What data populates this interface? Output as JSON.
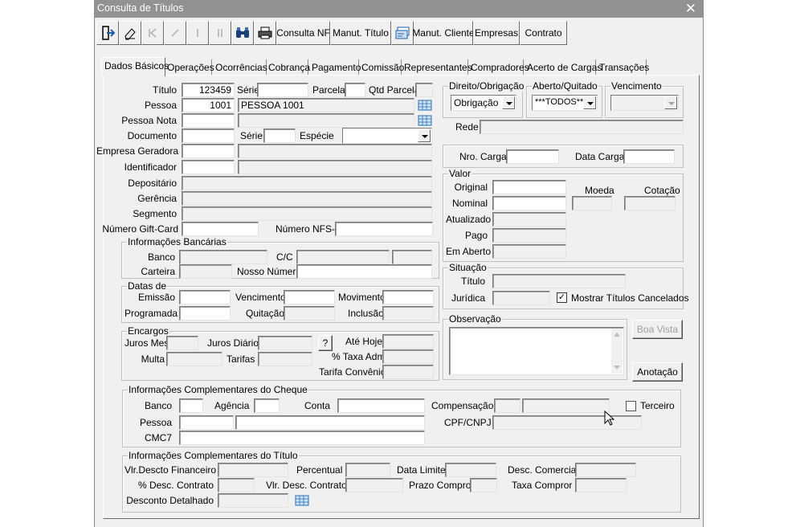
{
  "window": {
    "title": "Consulta de Títulos",
    "close_glyph": "✕"
  },
  "toolbar": {
    "exit_icon": "exit-door-icon",
    "eraser_icon": "eraser-icon",
    "first_icon": "first-record-icon",
    "confirm_icon": "check-icon",
    "bar_icon": "bar-icon",
    "pause_icon": "pause-icon",
    "search_icon": "binoculars-icon",
    "print_icon": "printer-icon",
    "consulta_nf": "Consulta NF",
    "manut_titulo": "Manut. Título",
    "card_icon": "card-icon",
    "manut_cliente": "Manut. Cliente",
    "empresas": "Empresas",
    "contrato": "Contrato"
  },
  "tabs": [
    "Dados Básicos",
    "Operações",
    "Ocorrências",
    "Cobrança",
    "Pagamento",
    "Comissão",
    "Representantes",
    "Compradores",
    "Acerto de Cargas",
    "Transações"
  ],
  "basic": {
    "titulo_label": "Título",
    "titulo_value": "123459",
    "serie_label": "Série",
    "parcela_label": "Parcela",
    "qtd_parcela_label": "Qtd Parcela",
    "pessoa_label": "Pessoa",
    "pessoa_code": "1001",
    "pessoa_name": "PESSOA 1001",
    "pessoa_nota_label": "Pessoa Nota",
    "documento_label": "Documento",
    "doc_serie_label": "Série",
    "especie_label": "Espécie",
    "empresa_geradora_label": "Empresa Geradora",
    "identificador_label": "Identificador",
    "depositario_label": "Depositário",
    "gerencia_label": "Gerência",
    "segmento_label": "Segmento",
    "gift_card_label": "Número Gift-Card",
    "nfse_label": "Número NFS-e"
  },
  "bancarias": {
    "legend": "Informações Bancárias",
    "banco_label": "Banco",
    "cc_label": "C/C",
    "carteira_label": "Carteira",
    "nosso_numero_label": "Nosso Número"
  },
  "datas": {
    "legend": "Datas de",
    "emissao": "Emissão",
    "vencimento": "Vencimento",
    "movimento": "Movimento",
    "programada": "Programada",
    "quitacao": "Quitação",
    "inclusao": "Inclusão"
  },
  "encargos": {
    "legend": "Encargos",
    "juros_mes": "Juros Mes",
    "juros_diario": "Juros Diário",
    "help_button": "?",
    "ate_hoje": "Até Hoje",
    "multa": "Multa",
    "tarifas": "Tarifas",
    "taxa_adm": "% Taxa Adm",
    "tarifa_convenio": "Tarifa Convênio"
  },
  "direito": {
    "legend": "Direito/Obrigação",
    "value": "Obrigação"
  },
  "aberto": {
    "legend": "Aberto/Quitado",
    "value": "***TODOS***"
  },
  "vencimento_group": {
    "legend": "Vencimento",
    "value": ""
  },
  "rede_label": "Rede",
  "carga": {
    "nro_label": "Nro. Carga",
    "data_label": "Data Carga"
  },
  "valor": {
    "legend": "Valor",
    "original": "Original",
    "nominal": "Nominal",
    "atualizado": "Atualizado",
    "pago": "Pago",
    "em_aberto": "Em Aberto",
    "moeda": "Moeda",
    "cotacao": "Cotação"
  },
  "situacao": {
    "legend": "Situação",
    "titulo": "Título",
    "juridica": "Jurídica",
    "mostrar_cancelados": "Mostrar Títulos Cancelados",
    "checked_glyph": "✓"
  },
  "observacao": {
    "legend": "Observação"
  },
  "buttons": {
    "boa_vista": "Boa Vista",
    "anotacao": "Anotação"
  },
  "cheque": {
    "legend": "Informações Complementares do Cheque",
    "banco": "Banco",
    "agencia": "Agência",
    "conta": "Conta",
    "compensacao": "Compensação",
    "terceiro": "Terceiro",
    "pessoa": "Pessoa",
    "cpf_cnpj": "CPF/CNPJ",
    "cmc7": "CMC7"
  },
  "comp_titulo": {
    "legend": "Informações Complementares do Título",
    "vlr_descto_fin": "Vlr.Descto Financeiro",
    "percentual": "Percentual",
    "data_limite": "Data Limite",
    "desc_comercial": "Desc. Comercial",
    "desc_contrato": "% Desc. Contrato",
    "vlr_desc_contrato": "Vlr. Desc. Contrato",
    "prazo_compror": "Prazo Compror",
    "taxa_compror": "Taxa Compror",
    "desconto_detalhado": "Desconto Detalhado"
  },
  "icons": {
    "lookup": "lookup-grid-icon",
    "mouse_cursor": "mouse-pointer-icon"
  },
  "colors": {
    "titlebar": "#929292",
    "window_bg": "#f0f0f0",
    "field_bg": "#ffffff",
    "lookup_icon": "#2a6fb0"
  }
}
